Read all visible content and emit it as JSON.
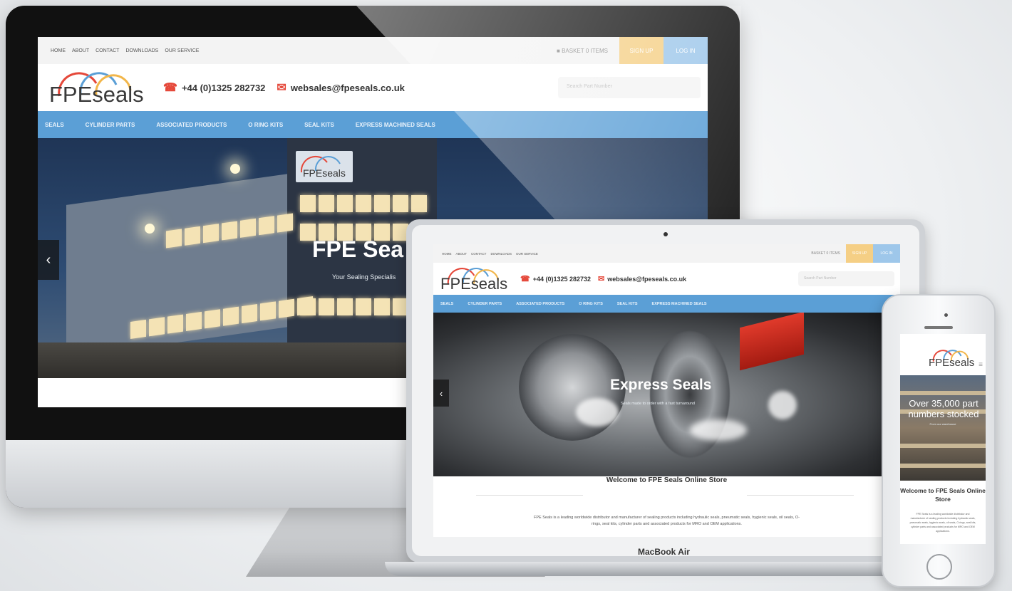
{
  "site": {
    "top_nav": [
      "HOME",
      "ABOUT",
      "CONTACT",
      "DOWNLOADS",
      "OUR SERVICE"
    ],
    "basket_label": "BASKET",
    "basket_count": "0 ITEMS",
    "signup_label": "SIGN UP",
    "login_label": "LOG IN",
    "logo_text": "FPEseals",
    "phone": "+44 (0)1325 282732",
    "email": "websales@fpeseals.co.uk",
    "search_placeholder": "Search Part Number",
    "main_nav": [
      "SEALS",
      "CYLINDER PARTS",
      "ASSOCIATED PRODUCTS",
      "O RING KITS",
      "SEAL KITS",
      "EXPRESS MACHINED SEALS"
    ],
    "building_sign": "FPEseals"
  },
  "desktop": {
    "hero_title": "FPE Sea",
    "hero_subtitle": "Your Sealing Specialis",
    "arrow": "‹"
  },
  "laptop": {
    "hero_title": "Express Seals",
    "hero_subtitle": "Seals made to order with a fast turnaround",
    "arrow": "‹",
    "welcome_title": "Welcome to FPE Seals Online Store",
    "welcome_body": "FPE Seals is a leading worldwide distributor and manufacturer of sealing products including hydraulic seals, pneumatic seals, hygienic seals, oil seals, O-rings, seal kits, cylinder parts and associated products for MRO and OEM applications.",
    "model_label": "MacBook Air"
  },
  "phone": {
    "hero_title": "Over 35,000 part numbers stocked",
    "hero_subtitle": "From our warehouse",
    "welcome_title": "Welcome to FPE Seals Online Store",
    "welcome_body": "FPE Seals is a leading worldwide distributor and manufacturer of sealing products including hydraulic seals, pneumatic seals, hygienic seals, oil seals, O-rings, seal kits, cylinder parts and associated products for MRO and OEM applications.",
    "menu_icon": "≡"
  },
  "colors": {
    "nav_blue": "#5b9fd6",
    "signup_orange": "#f5cf85",
    "login_blue": "#9ec7ea",
    "icon_red": "#e5483a"
  },
  "icons": {
    "phone_icon": "☎",
    "email_icon": "✉",
    "basket_icon": "🛒",
    "apple_icon": ""
  }
}
